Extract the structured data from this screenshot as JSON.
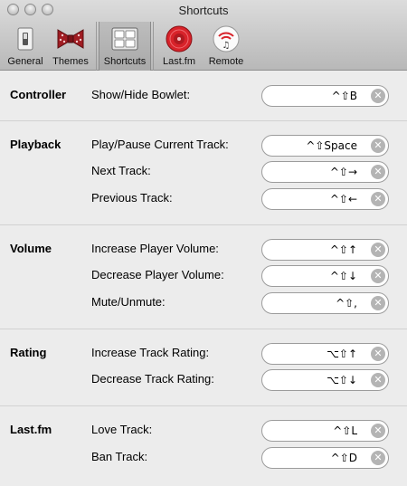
{
  "window": {
    "title": "Shortcuts"
  },
  "toolbar": {
    "items": [
      {
        "label": "General"
      },
      {
        "label": "Themes"
      },
      {
        "label": "Shortcuts"
      },
      {
        "label": "Last.fm"
      },
      {
        "label": "Remote"
      }
    ],
    "selected": "Shortcuts"
  },
  "sections": [
    {
      "title": "Controller",
      "rows": [
        {
          "label": "Show/Hide Bowlet:",
          "shortcut": "^⇧B"
        }
      ]
    },
    {
      "title": "Playback",
      "rows": [
        {
          "label": "Play/Pause Current Track:",
          "shortcut": "^⇧Space"
        },
        {
          "label": "Next Track:",
          "shortcut": "^⇧→"
        },
        {
          "label": "Previous Track:",
          "shortcut": "^⇧←"
        }
      ]
    },
    {
      "title": "Volume",
      "rows": [
        {
          "label": "Increase Player Volume:",
          "shortcut": "^⇧↑"
        },
        {
          "label": "Decrease Player Volume:",
          "shortcut": "^⇧↓"
        },
        {
          "label": "Mute/Unmute:",
          "shortcut": "^⇧,"
        }
      ]
    },
    {
      "title": "Rating",
      "rows": [
        {
          "label": "Increase Track Rating:",
          "shortcut": "⌥⇧↑"
        },
        {
          "label": "Decrease Track Rating:",
          "shortcut": "⌥⇧↓"
        }
      ]
    },
    {
      "title": "Last.fm",
      "rows": [
        {
          "label": "Love Track:",
          "shortcut": "^⇧L"
        },
        {
          "label": "Ban Track:",
          "shortcut": "^⇧D"
        }
      ]
    }
  ],
  "icons": {
    "clear": "clear-field-icon",
    "general": "general-switch-icon",
    "themes": "bowtie-icon",
    "shortcuts": "keyboard-keys-icon",
    "lastfm": "lastfm-record-icon",
    "remote": "remote-wifi-icon"
  },
  "colors": {
    "lastfm_red": "#d8232a",
    "bowtie_red": "#a01c22"
  }
}
